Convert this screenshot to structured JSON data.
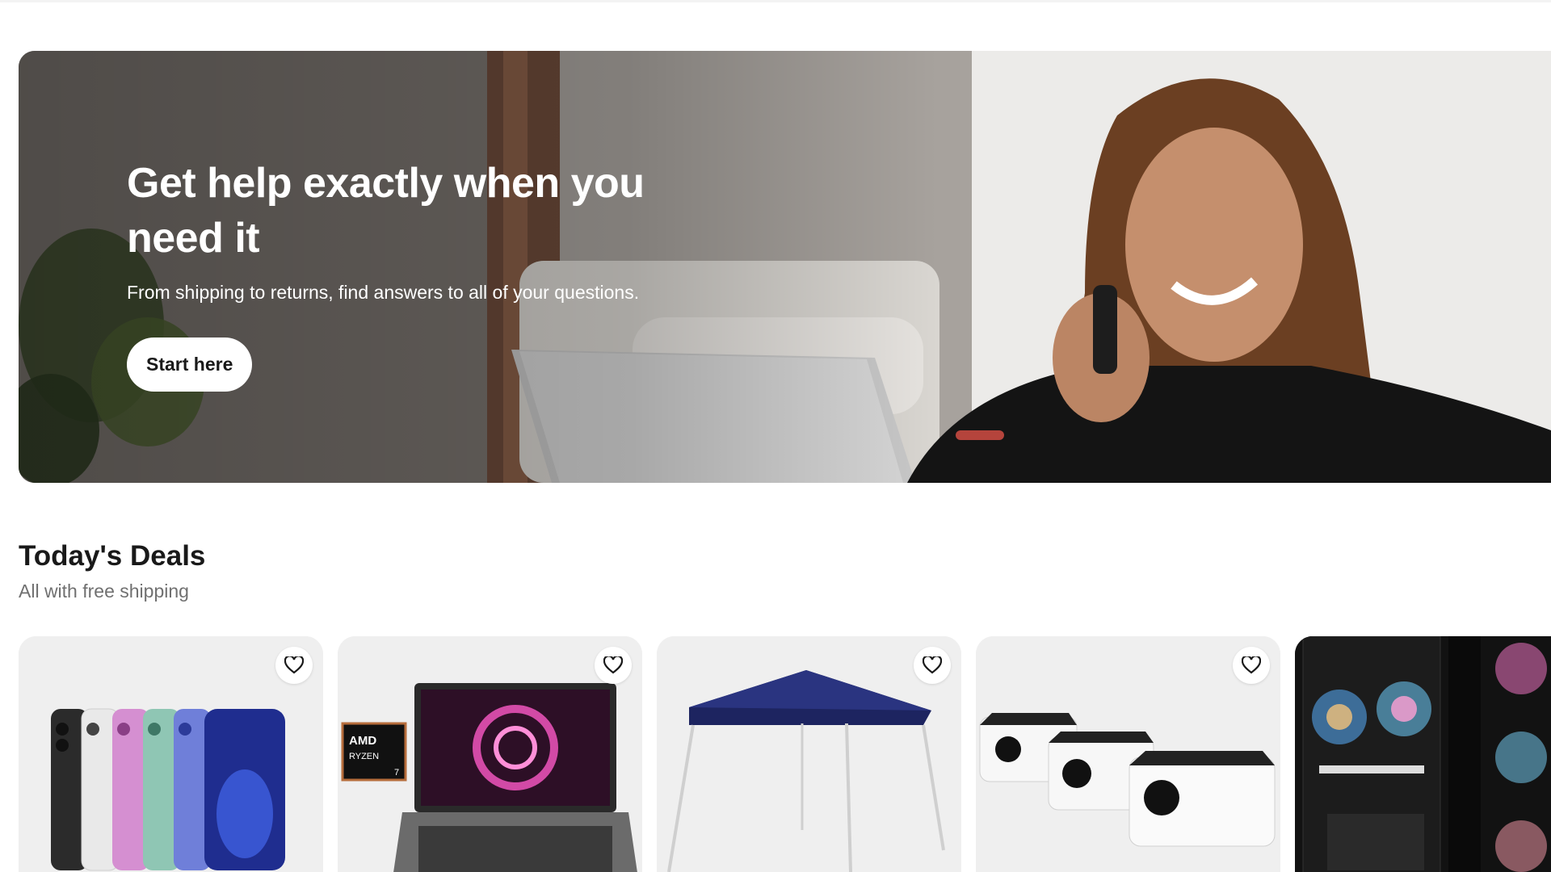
{
  "hero": {
    "title": "Get help exactly when you need it",
    "subtitle": "From shipping to returns, find answers to all of your questions.",
    "button_label": "Start here"
  },
  "deals": {
    "title": "Today's Deals",
    "subtitle": "All with free shipping",
    "items": [
      {
        "name": "iphone-lineup",
        "icon": "heart-icon"
      },
      {
        "name": "gaming-laptop",
        "badge_line1": "AMD",
        "badge_line2": "RYZEN",
        "badge_line3": "7",
        "icon": "heart-icon"
      },
      {
        "name": "canopy-tent",
        "icon": "heart-icon"
      },
      {
        "name": "security-cameras",
        "icon": "heart-icon"
      },
      {
        "name": "gaming-pc",
        "icon": "heart-icon"
      }
    ]
  },
  "colors": {
    "text_primary": "#191919",
    "text_secondary": "#707070",
    "card_bg": "#efefef"
  }
}
